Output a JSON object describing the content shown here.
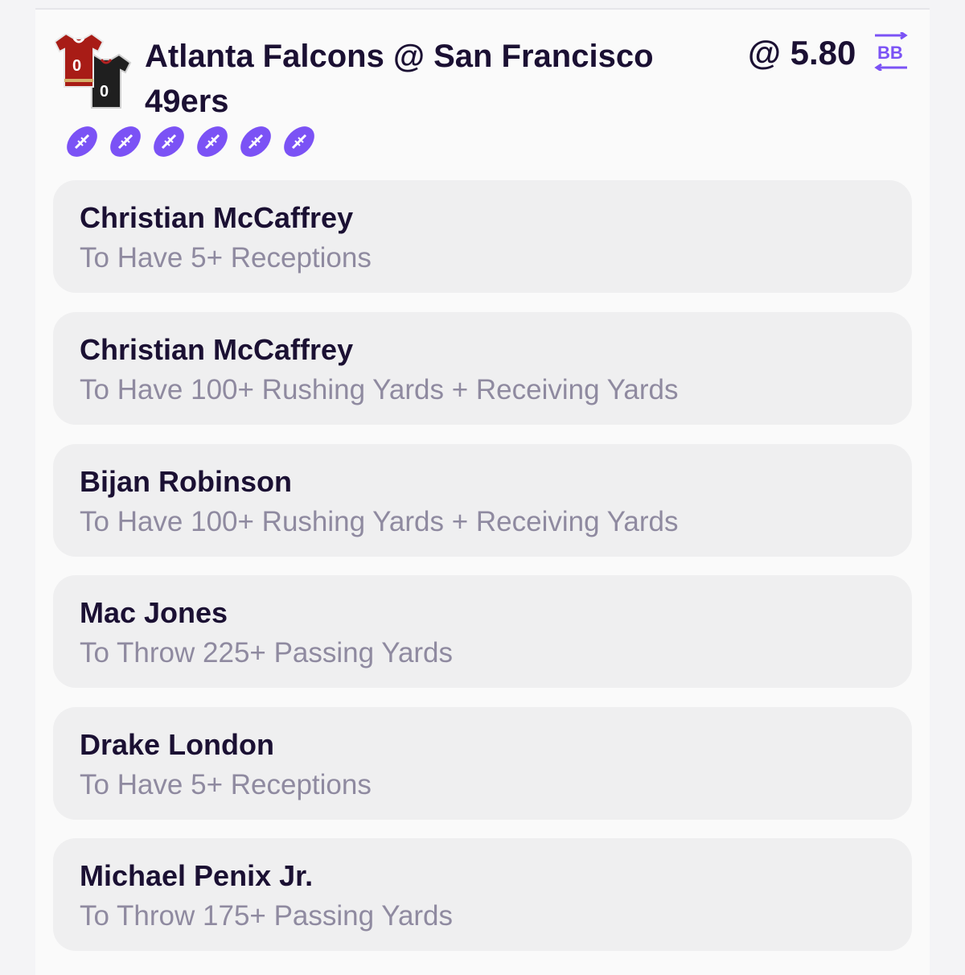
{
  "header": {
    "title": "Atlanta Falcons @ San Francisco 49ers",
    "odds": "@ 5.80",
    "bb_label": "BB",
    "jersey_numbers": [
      "0",
      "0"
    ],
    "icons": [
      "jerseys-icon",
      "football-icon",
      "bet-builder-icon"
    ],
    "football_count": 6
  },
  "colors": {
    "accent": "#7b52f5",
    "title": "#1b1033",
    "subtitle": "#8f8aa0",
    "leg_background": "#efeff0"
  },
  "legs": [
    {
      "player": "Christian McCaffrey",
      "market": "To Have 5+ Receptions"
    },
    {
      "player": "Christian McCaffrey",
      "market": "To Have 100+ Rushing Yards + Receiving Yards"
    },
    {
      "player": "Bijan Robinson",
      "market": "To Have 100+ Rushing Yards + Receiving Yards"
    },
    {
      "player": "Mac Jones",
      "market": "To Throw 225+ Passing Yards"
    },
    {
      "player": "Drake London",
      "market": "To Have 5+ Receptions"
    },
    {
      "player": "Michael Penix Jr.",
      "market": "To Throw 175+ Passing Yards"
    }
  ]
}
